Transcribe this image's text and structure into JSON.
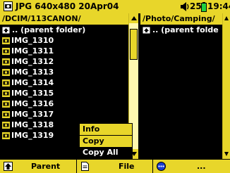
{
  "status": {
    "file_info": "JPG 640x480 20Apr04",
    "volume": "25",
    "time": "19:44"
  },
  "left_pane": {
    "path": "/DCIM/113CANON/",
    "parent_label": ".. (parent folder)",
    "items": [
      "IMG_1310",
      "IMG_1311",
      "IMG_1312",
      "IMG_1313",
      "IMG_1314",
      "IMG_1315",
      "IMG_1316",
      "IMG_1317",
      "IMG_1318",
      "IMG_1319"
    ]
  },
  "right_pane": {
    "path": "/Photo/Camping/",
    "parent_label": ".. (parent folde"
  },
  "context_menu": {
    "items": [
      "Info",
      "Copy",
      "Copy All"
    ]
  },
  "bottom_bar": {
    "parent_label": "Parent",
    "file_label": "File",
    "more_label": "..."
  },
  "colors": {
    "accent": "#e8d62a",
    "background": "#000000",
    "text": "#ffffff"
  }
}
